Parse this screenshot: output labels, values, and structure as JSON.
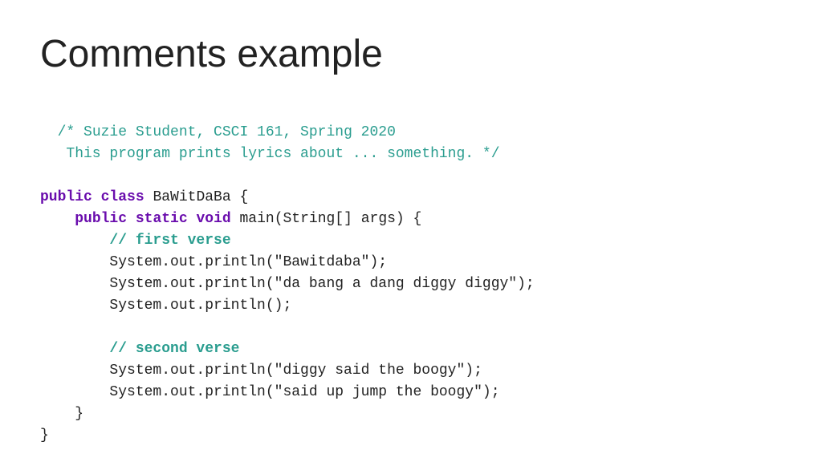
{
  "page": {
    "title": "Comments example"
  },
  "code": {
    "block_comment_line1": "/* Suzie Student, CSCI 161, Spring 2020",
    "block_comment_line2": "   This program prints lyrics about ... something. */",
    "blank1": "",
    "class_decl": "public class BaWitDaBa {",
    "main_decl": "    public static void main(String[] args) {",
    "comment1": "        // first verse",
    "println1": "        System.out.println(\"Bawitdaba\");",
    "println2": "        System.out.println(\"da bang a dang diggy diggy\");",
    "println3": "        System.out.println();",
    "blank2": "",
    "comment2": "        // second verse",
    "println4": "        System.out.println(\"diggy said the boogy\");",
    "println5": "        System.out.println(\"said up jump the boogy\");",
    "close_main": "    }",
    "close_class": "}"
  }
}
